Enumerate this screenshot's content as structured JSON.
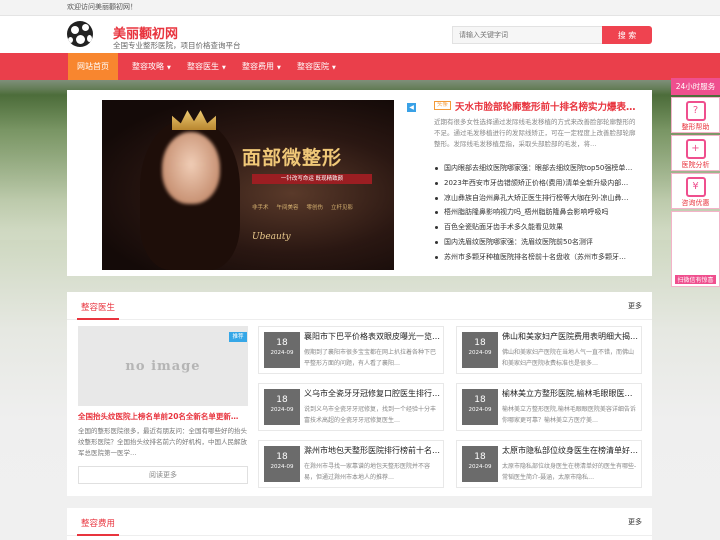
{
  "topbar": {
    "welcome": "欢迎访问美丽颧初网！"
  },
  "header": {
    "site_name": "美丽颧初网",
    "tagline": "全国专业整形医院，项目价格查询平台",
    "search_placeholder": "请输入关键字词",
    "search_button": "搜 索"
  },
  "nav": [
    {
      "label": "网站首页",
      "active": true,
      "has_menu": false
    },
    {
      "label": "整容攻略",
      "has_menu": true
    },
    {
      "label": "整容医生",
      "has_menu": true
    },
    {
      "label": "整容费用",
      "has_menu": true
    },
    {
      "label": "整容医院",
      "has_menu": true
    }
  ],
  "banner": {
    "title": "面部微整形",
    "subtitle": "一针改写命运 既现精致颜",
    "features": [
      "非手术",
      "午间美容",
      "零创伤",
      "立杆见影"
    ],
    "brand": "Ubeauty"
  },
  "headline": {
    "tag": "头条",
    "title": "天水市脸部轮廓整形前十排名榜实力爆表（…",
    "desc": "近期有很多女性选择通过发际线毛发移植的方式来改善脸部轮廓整形的不足。通过毛发移植进行的发际线矫正，可在一定程度上改善脸部轮廓整形。发际线毛发移植是指，采取头部脸部的毛发，将…",
    "list": [
      "国内眼部去细纹医院哪家强：眼部去细纹医院top50强榜单…",
      "2023年西安市牙齿错颌矫正价格(费用)清单全新升级内部…",
      "凉山彝族自治州鼻孔大矫正医生排行榜等大咖在列-凉山彝…",
      "梧州脂肪隆鼻影响视力吗_梧州脂肪隆鼻会影响呼吸吗",
      "百色全瓷贴面牙齿手术多久能看见效果",
      "国内洗眉纹医院哪家强：洗眉纹医院前50名测评",
      "苏州市多颗牙种植医院排名榜前十名盘收（苏州市多颗牙…"
    ]
  },
  "sidebar": {
    "top": "24小时服务",
    "items": [
      {
        "label": "整形帮助",
        "icon": "help-icon",
        "glyph": "?"
      },
      {
        "label": "医院分析",
        "icon": "hospital-icon",
        "glyph": "+"
      },
      {
        "label": "咨询优惠",
        "icon": "chat-icon",
        "glyph": "¥"
      }
    ],
    "qr_caption": "扫微信有惊喜"
  },
  "sections": {
    "doctors": {
      "title": "整容医生",
      "more": "更多"
    },
    "fees": {
      "title": "整容费用",
      "more": "更多"
    }
  },
  "featured": {
    "image_alt": "no image",
    "badge": "推荐",
    "title": "全国抬头纹医院上榜名单前20名全新名单更新…",
    "desc": "全国的整形医院很多，最近有朋友问：全国有哪些好的抬头纹整形医院？全国抬头纹排名前六的好机构，中国人民解放军总医院第一医学…",
    "more": "阅读更多"
  },
  "cards": [
    {
      "day": "18",
      "ym": "2024-09",
      "title": "襄阳市下巴平价格表双眼皮曝光一览…",
      "desc": "假期到了襄阳市很多宝宝都在网上扒拉着各种下巴平整形方面的问题，有人看了襄阳…"
    },
    {
      "day": "18",
      "ym": "2024-09",
      "title": "佛山和美家妇产医院费用表明细大揭…",
      "desc": "佛山和美家妇产医院在当地人气一直不错，而佛山和美家妇产医院收费标准也是很多…"
    },
    {
      "day": "18",
      "ym": "2024-09",
      "title": "义乌市全瓷牙牙冠修复口腔医生排行…",
      "desc": "说到义乌市全瓷牙牙冠修复，找到一个经验十分丰富技术高超的全瓷牙牙冠修复医生…"
    },
    {
      "day": "18",
      "ym": "2024-09",
      "title": "榆林美立方整形医院,榆林毛眼眼医…",
      "desc": "榆林美立方整形医院,榆林毛眼眼医院美容详细告诉你哪家更可靠？榆林美立方医疗美…"
    },
    {
      "day": "18",
      "ym": "2024-09",
      "title": "滁州市地包天整形医院排行榜前十名…",
      "desc": "在滁州市寻找一家靠谱的地包天整形医院并不容易，但通过滁州市本地人的推荐…"
    },
    {
      "day": "18",
      "ym": "2024-09",
      "title": "太原市隐私部位纹身医生在榜清单好…",
      "desc": "太原市隐私部位纹身医生在榜清单好的医生有哪些-常韬医生简介-聂涵，太原市隐私…"
    }
  ]
}
